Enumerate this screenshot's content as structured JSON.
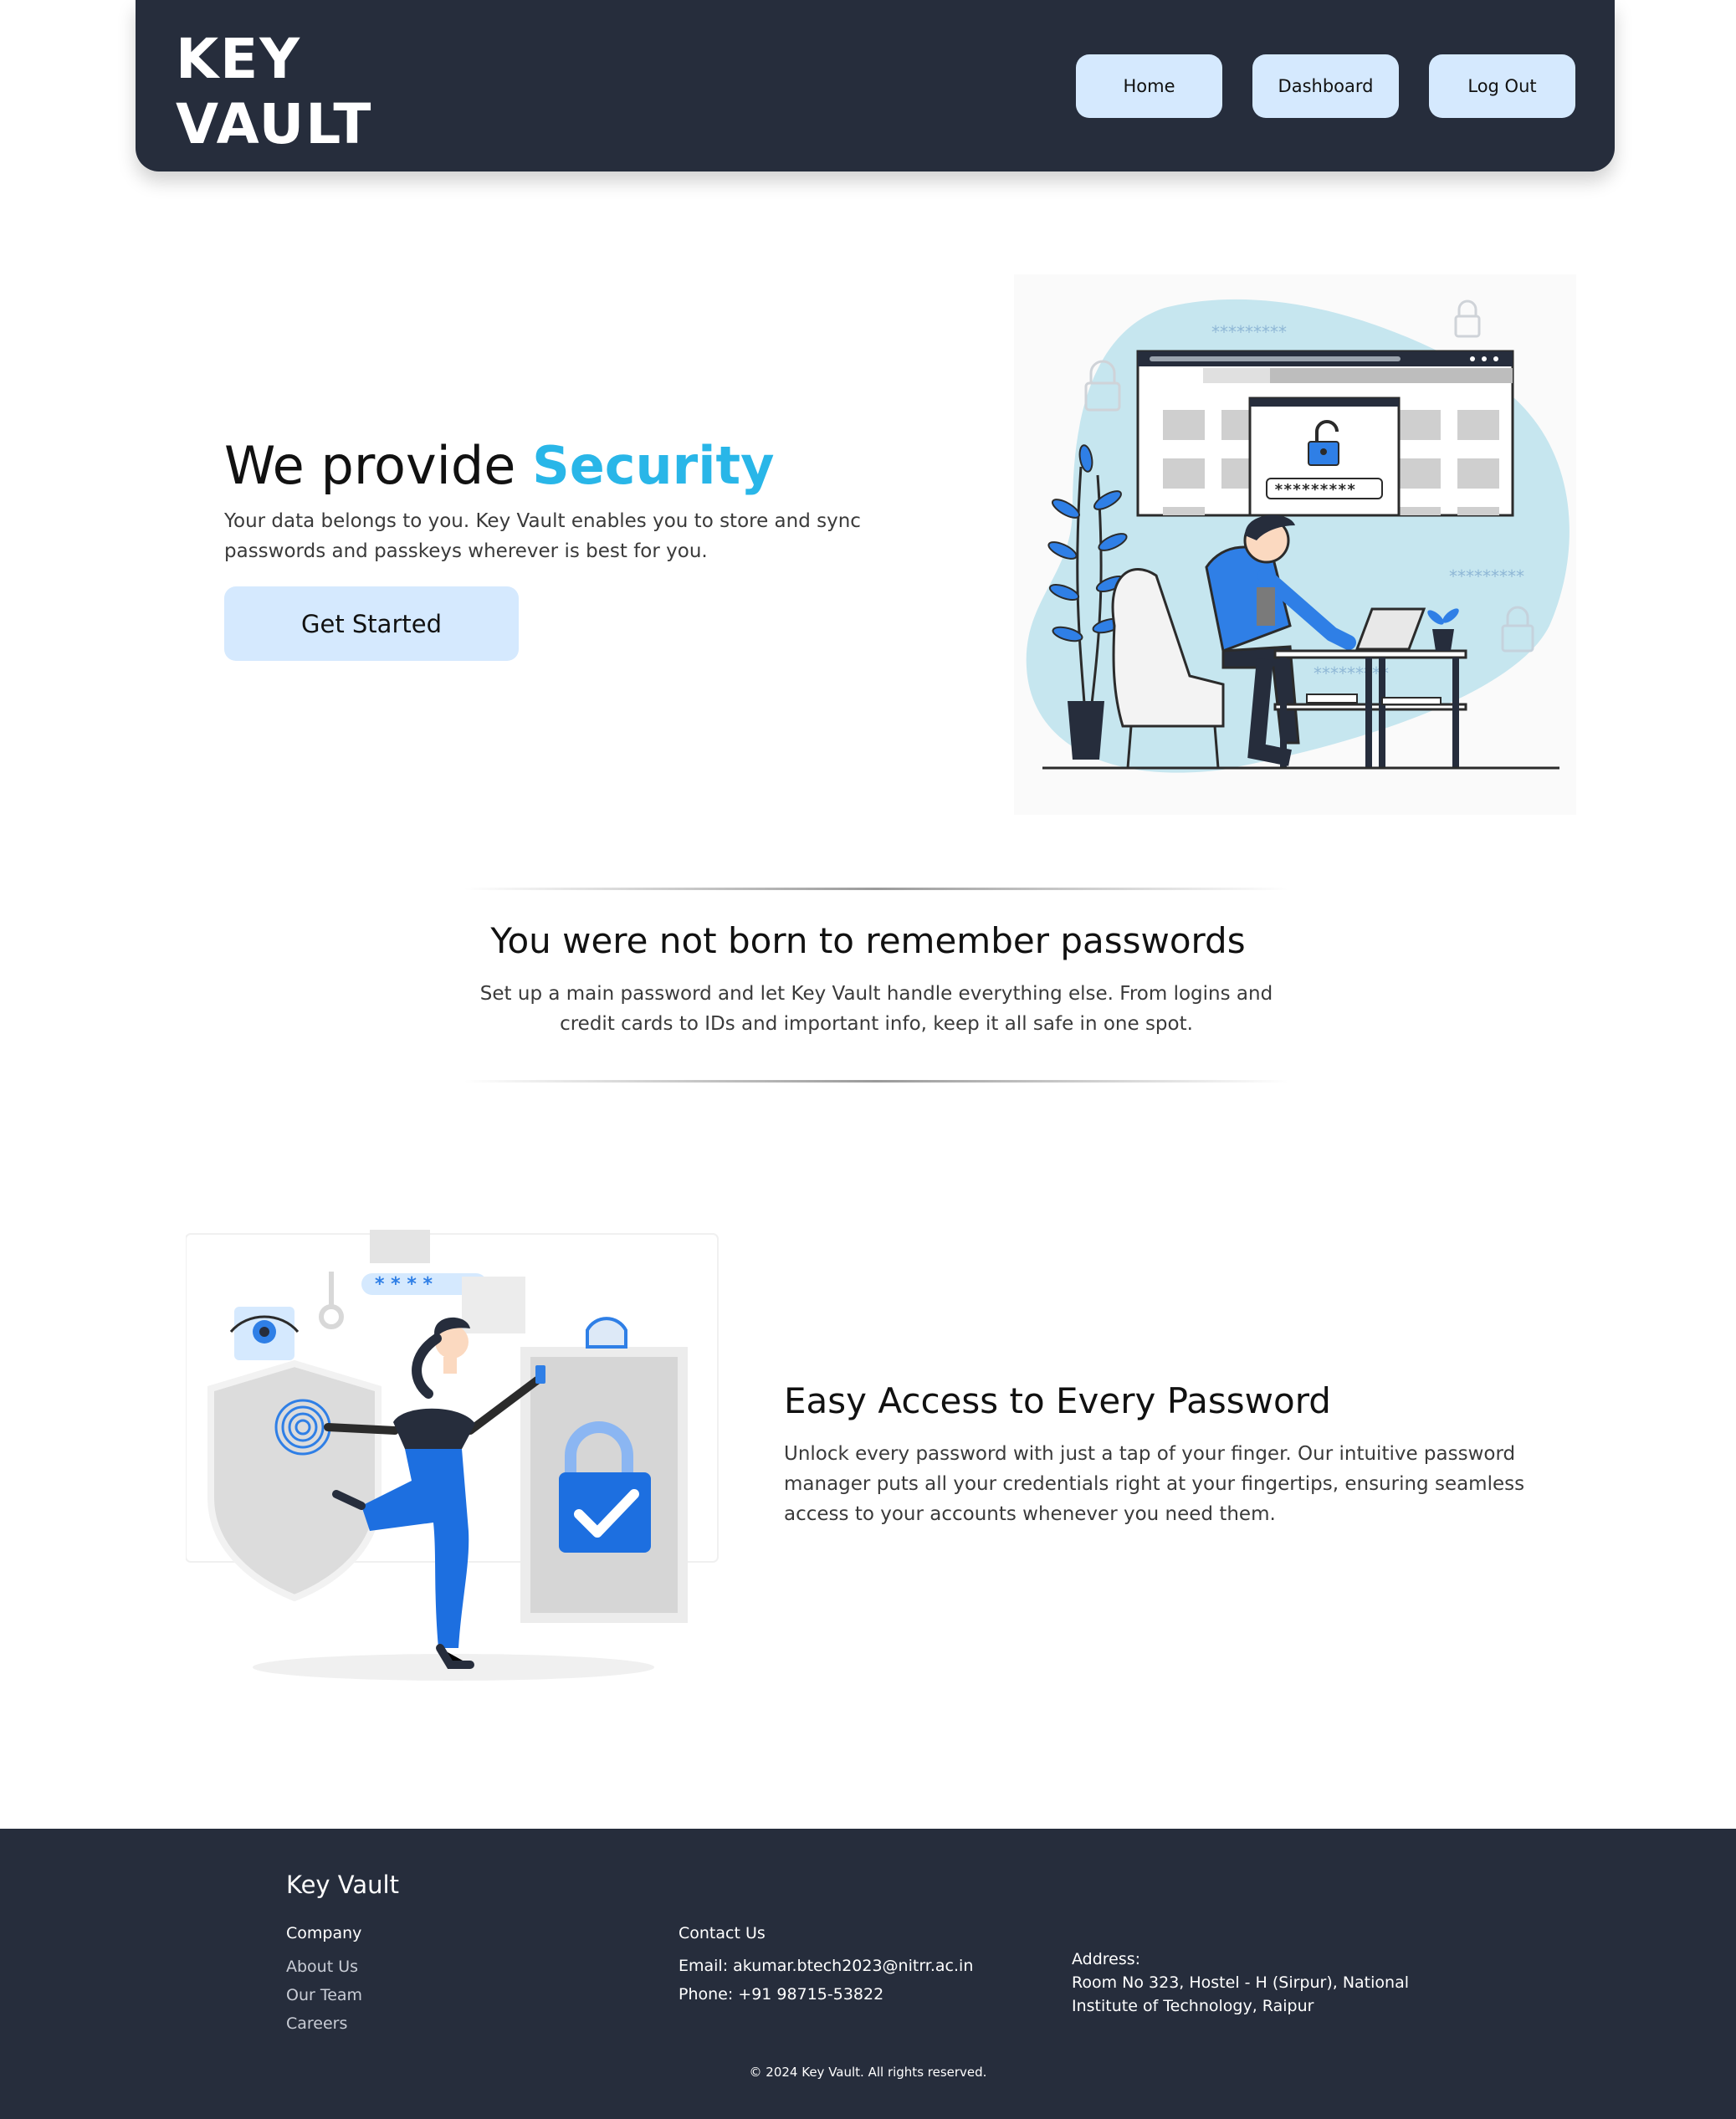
{
  "header": {
    "logo_line1": "KEY",
    "logo_line2": "VAULT",
    "nav": {
      "home": "Home",
      "dashboard": "Dashboard",
      "logout": "Log Out"
    }
  },
  "hero": {
    "title_prefix": "We provide",
    "title_accent": "Security",
    "subtitle": "Your data belongs to you. Key Vault enables you to store and sync passwords and passkeys wherever is best for you.",
    "cta": "Get Started",
    "art": {
      "password_mask": "*********",
      "stars_right": "*********",
      "stars_top": "*********",
      "stars_desk": "*********"
    }
  },
  "middle": {
    "title": "You were not born to remember passwords",
    "subtitle": "Set up a main password and let Key Vault handle everything else. From logins and credit cards to IDs and important info, keep it all safe in one spot."
  },
  "feature": {
    "title": "Easy Access to Every Password",
    "subtitle": "Unlock every password with just a tap of your finger. Our intuitive password manager puts all your credentials right at your fingertips, ensuring seamless access to your accounts whenever you need them.",
    "art": {
      "stars": "* * * *"
    }
  },
  "footer": {
    "brand": "Key Vault",
    "company_heading": "Company",
    "links": [
      "About Us",
      "Our Team",
      "Careers"
    ],
    "contact_heading": "Contact Us",
    "email": "Email: akumar.btech2023@nitrr.ac.in",
    "phone": "Phone: +91 98715-53822",
    "address_label": "Address:",
    "address_line1": "Room No 323, Hostel - H (Sirpur), National",
    "address_line2": "Institute of Technology, Raipur",
    "copyright": "© 2024 Key Vault. All rights reserved."
  },
  "colors": {
    "header_bg": "#262d3c",
    "button_bg": "#d5e9fe",
    "accent": "#29b6e8",
    "illustration_blue": "#2f7fe6",
    "illustration_light": "#c6e6ef"
  }
}
